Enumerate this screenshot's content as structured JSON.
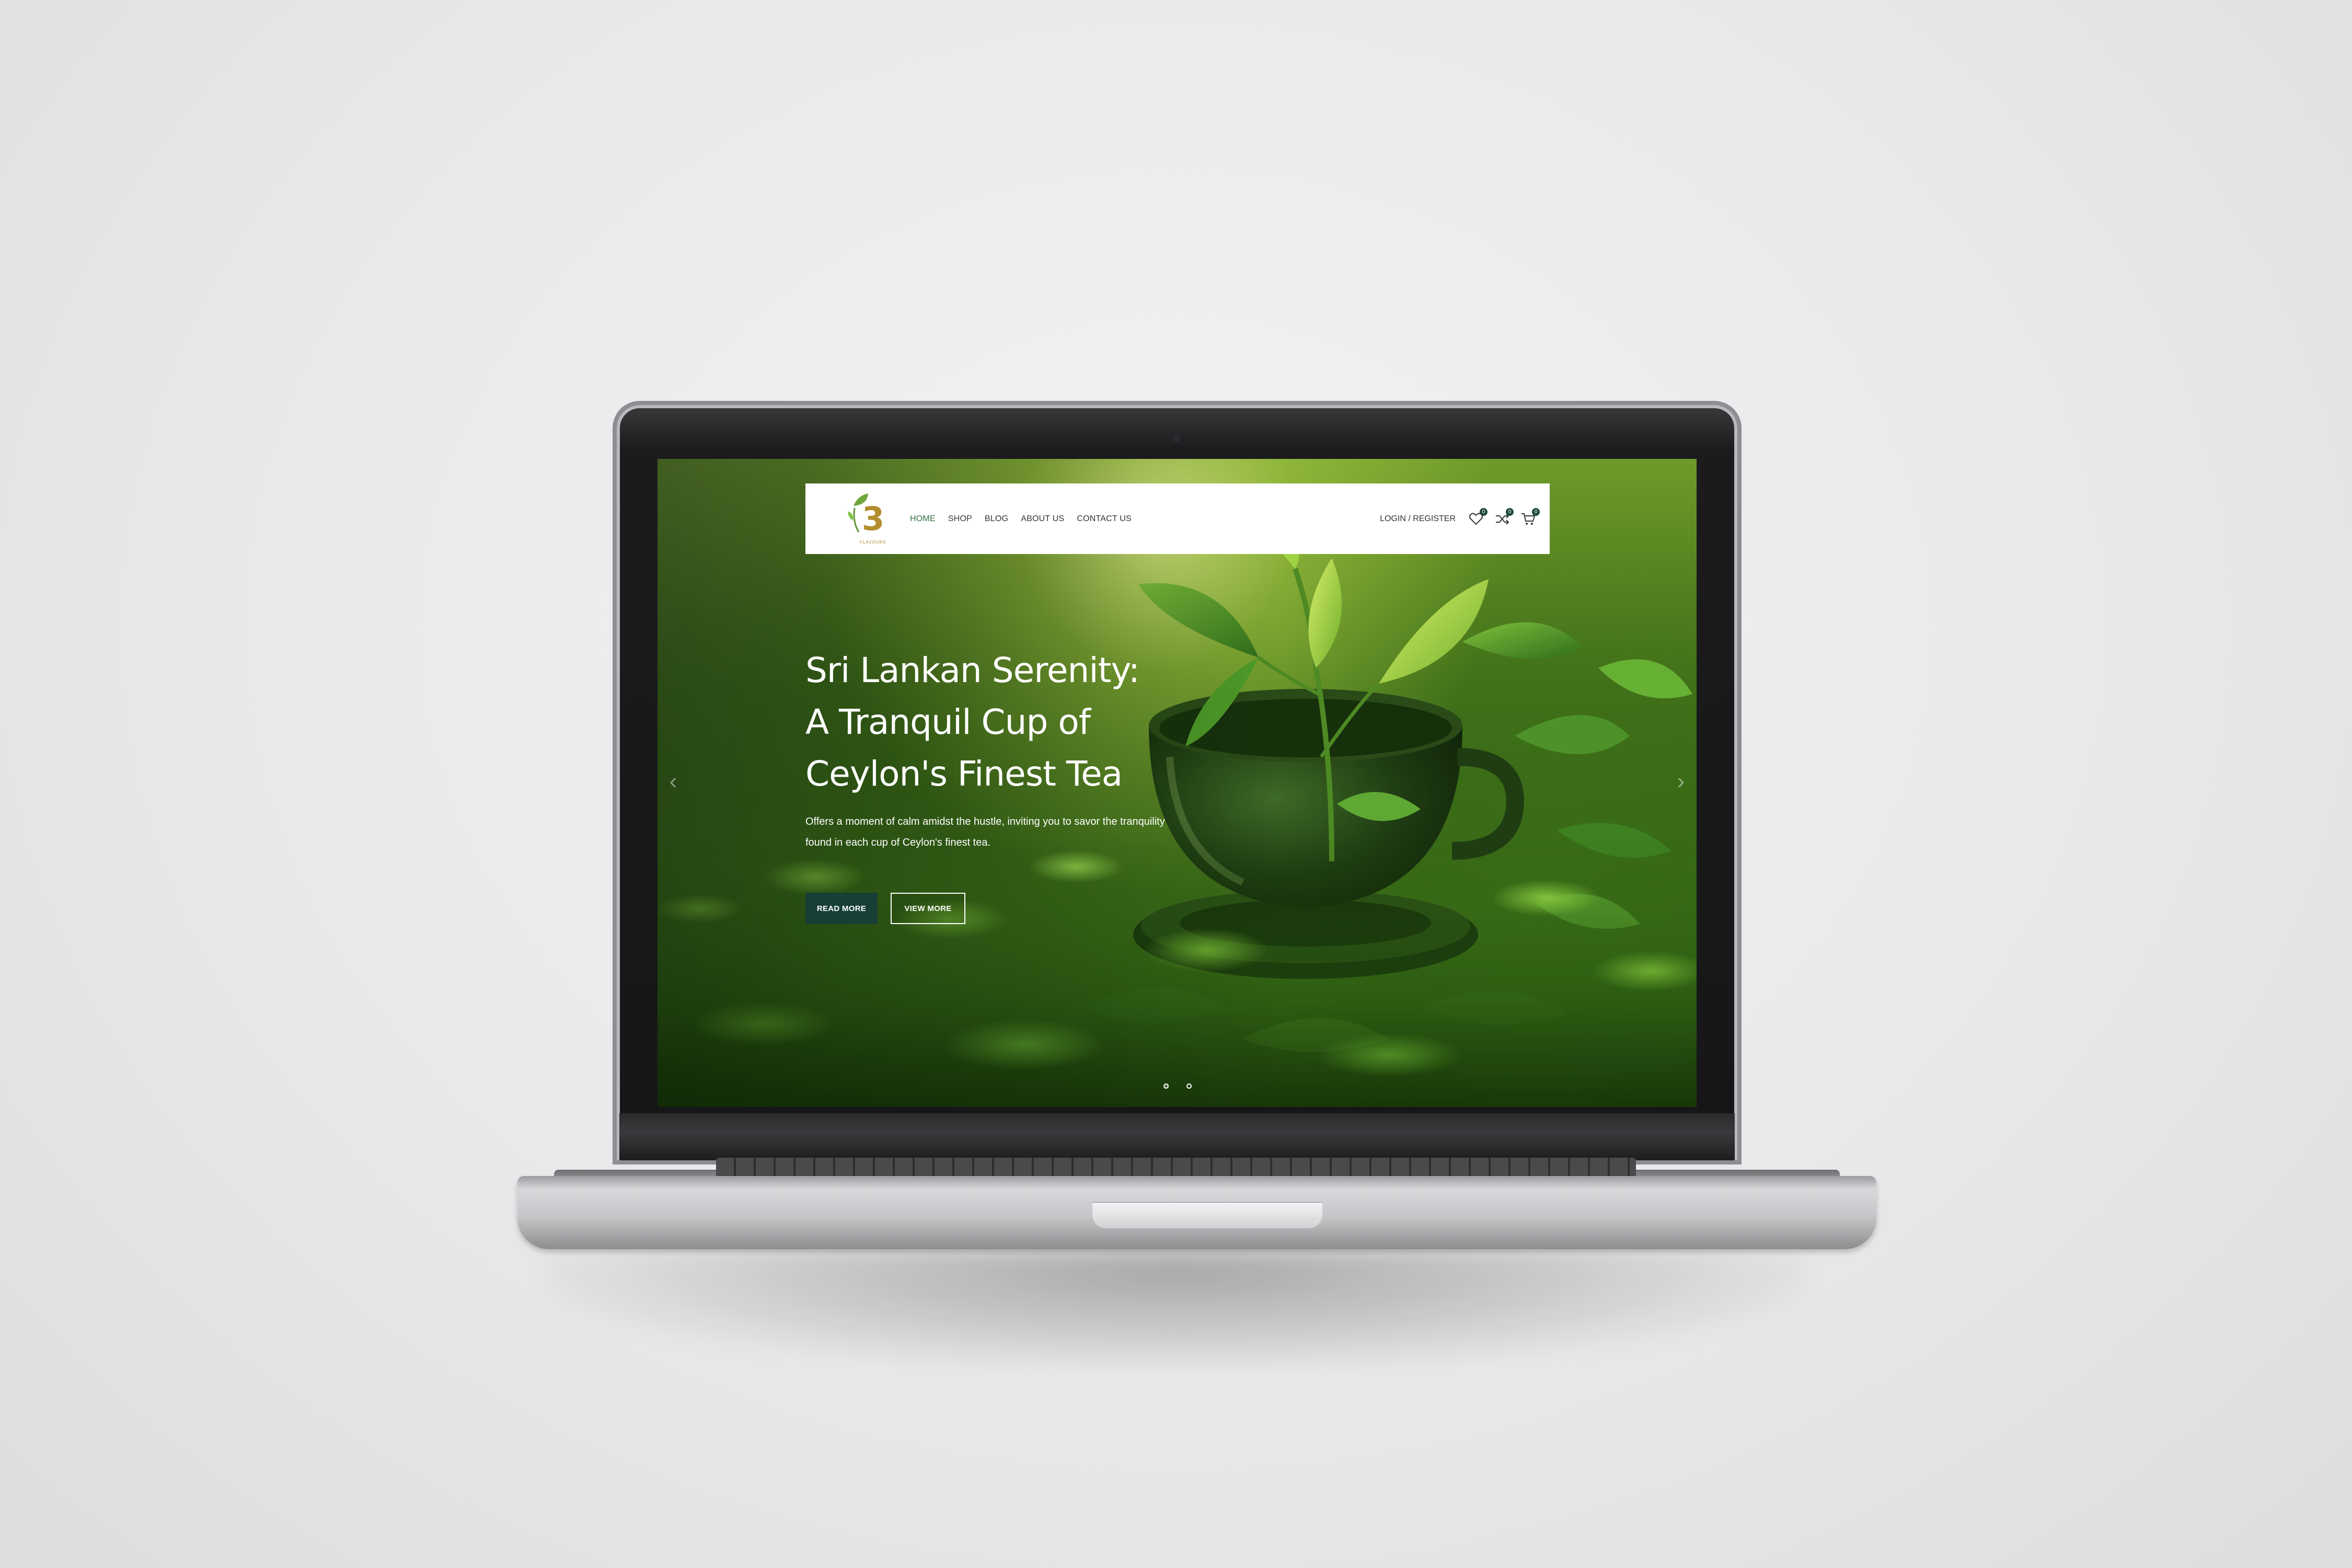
{
  "site": {
    "logo": {
      "icon": "3-flavours-leaf-logo",
      "caption": "FLAVOURS"
    },
    "nav": {
      "items": [
        {
          "label": "HOME",
          "active": true
        },
        {
          "label": "SHOP",
          "active": false
        },
        {
          "label": "BLOG",
          "active": false
        },
        {
          "label": "ABOUT US",
          "active": false
        },
        {
          "label": "CONTACT US",
          "active": false
        }
      ]
    },
    "header_actions": {
      "login_label": "LOGIN / REGISTER",
      "wishlist": {
        "icon": "heart-icon",
        "count": "0"
      },
      "compare": {
        "icon": "shuffle-icon",
        "count": "0"
      },
      "cart": {
        "icon": "cart-icon",
        "count": "0"
      }
    },
    "hero": {
      "title_lines": [
        "Sri Lankan Serenity:",
        "A Tranquil Cup of",
        "Ceylon's Finest Tea"
      ],
      "description_lines": [
        "Offers a moment of calm amidst the hustle, inviting you to savor the tranquility",
        "found in each cup of Ceylon's finest tea."
      ],
      "primary_button": "READ MORE",
      "secondary_button": "VIEW MORE",
      "prev_arrow": "‹",
      "next_arrow": "›",
      "slide_count": 2,
      "active_slide": 1
    },
    "colors": {
      "brand_dark_green": "#173f36",
      "nav_active": "#2f6b3d",
      "logo_gold": "#b08a2a",
      "logo_green": "#6aa338"
    }
  }
}
